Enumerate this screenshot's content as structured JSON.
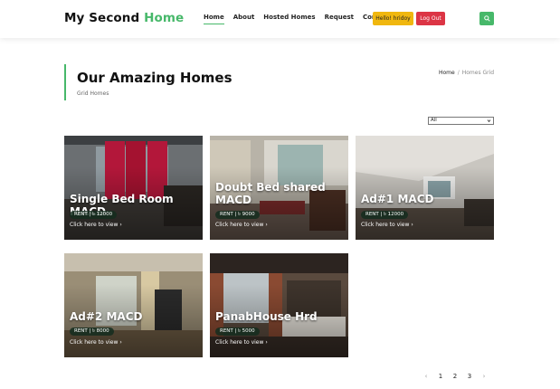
{
  "brand": {
    "part1": "My Second",
    "part2": "Home"
  },
  "nav": {
    "items": [
      {
        "label": "Home",
        "active": true
      },
      {
        "label": "About"
      },
      {
        "label": "Hosted Homes"
      },
      {
        "label": "Request"
      },
      {
        "label": "Contact"
      }
    ],
    "hello_label": "Hello! hridoy",
    "logout_label": "Log Out",
    "search_icon": "search-icon"
  },
  "header": {
    "title": "Our Amazing Homes",
    "subtitle": "Grid Homes",
    "breadcrumb": {
      "home": "Home",
      "separator": "/",
      "current": "Homes Grid"
    }
  },
  "filter": {
    "selected": "All"
  },
  "listings": [
    {
      "title": "Single Bed Room MACD",
      "badge": "RENT | ৳ 12000",
      "cta": "Click here to view"
    },
    {
      "title": "Doubt Bed shared MACD",
      "badge": "RENT | ৳ 9000",
      "cta": "Click here to view"
    },
    {
      "title": "Ad#1 MACD",
      "badge": "RENT | ৳ 12000",
      "cta": "Click here to view"
    },
    {
      "title": "Ad#2 MACD",
      "badge": "RENT | ৳ 8000",
      "cta": "Click here to view"
    },
    {
      "title": "PanabHouse Hrd",
      "badge": "RENT | ৳ 5000",
      "cta": "Click here to view"
    }
  ],
  "pagination": {
    "prev": "‹",
    "pages": [
      "1",
      "2",
      "3"
    ],
    "next": "›"
  },
  "colors": {
    "accent": "#47b86a",
    "hello": "#f0b70f",
    "logout": "#dc3545"
  }
}
